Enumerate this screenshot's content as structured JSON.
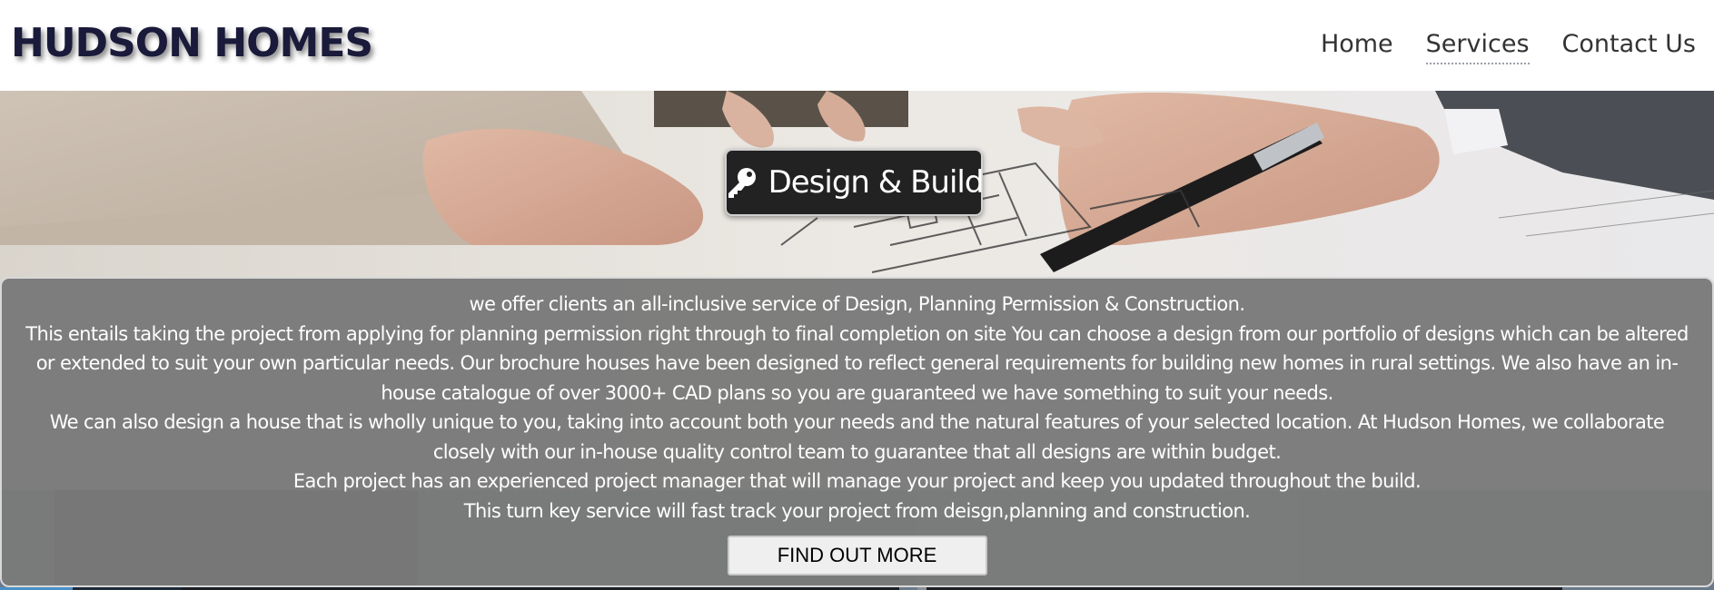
{
  "header": {
    "brand": "HUDSON HOMES",
    "nav": [
      {
        "label": "Home",
        "active": false
      },
      {
        "label": "Services",
        "active": true
      },
      {
        "label": "Contact Us",
        "active": false
      }
    ]
  },
  "hero": {
    "badge_icon": "key-icon",
    "badge_title": "Design & Build",
    "paragraphs": [
      "we offer clients an all-inclusive service of Design, Planning Permission & Construction.",
      "This entails taking the project from applying for planning permission right through to final completion on site You can choose a design from our portfolio of designs which can be altered or extended to suit your own particular needs. Our brochure houses have been designed to reflect general requirements for building new homes in rural settings. We also have an in-house catalogue of over 3000+ CAD plans so you are guaranteed we have something to suit your needs.",
      "We can also design a house that is wholly unique to you, taking into account both your needs and the natural features of your selected location. At Hudson Homes, we collaborate closely with our in-house quality control team to guarantee that all designs are within budget.",
      "Each project has an experienced project manager that will manage your project and keep you updated throughout the build.",
      "This turn key service will fast track your project from deisgn,planning and construction."
    ],
    "cta_label": "FIND OUT MORE"
  },
  "colors": {
    "brand_text": "#1a1a3a",
    "panel_bg": "#7a7a7a",
    "badge_bg": "#222222"
  }
}
